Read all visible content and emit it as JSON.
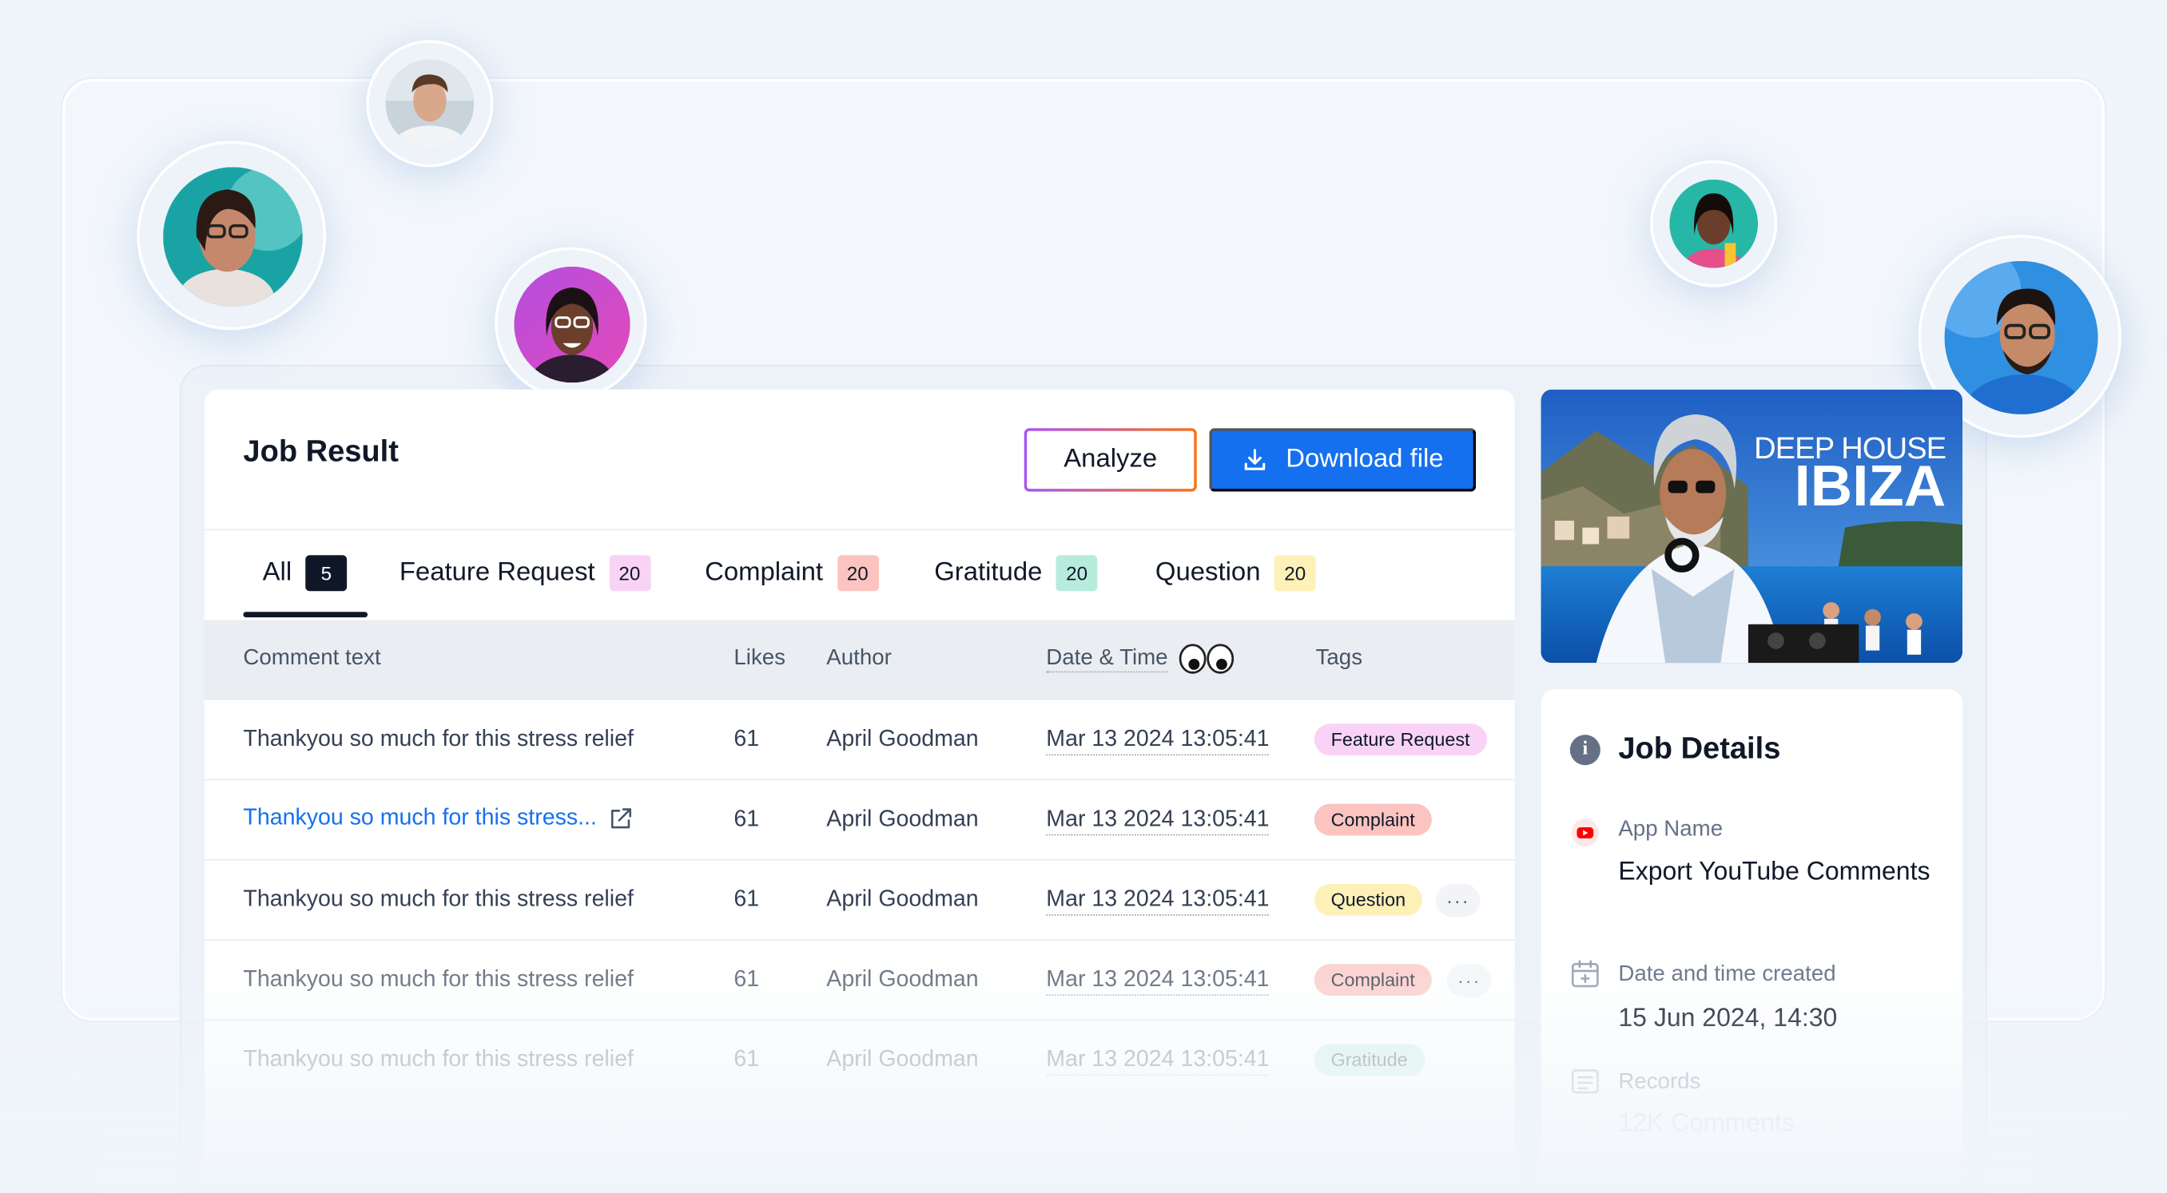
{
  "job_result": {
    "title": "Job Result",
    "analyze_label": "Analyze",
    "download_label": "Download file",
    "tabs": [
      {
        "label": "All",
        "count": "5",
        "color": "#101828",
        "text_color": "#ffffff"
      },
      {
        "label": "Feature Request",
        "count": "20",
        "color": "#f9d3f5",
        "text_color": "#101828"
      },
      {
        "label": "Complaint",
        "count": "20",
        "color": "#fbc4c0",
        "text_color": "#101828"
      },
      {
        "label": "Gratitude",
        "count": "20",
        "color": "#b7ecdd",
        "text_color": "#101828"
      },
      {
        "label": "Question",
        "count": "20",
        "color": "#fdf1b8",
        "text_color": "#101828"
      }
    ],
    "columns": {
      "comment": "Comment text",
      "likes": "Likes",
      "author": "Author",
      "date": "Date & Time",
      "tags": "Tags"
    },
    "rows": [
      {
        "comment": "Thankyou so much for this stress relief",
        "likes": "61",
        "author": "April Goodman",
        "date": "Mar 13 2024 13:05:41",
        "tag": "Feature Request",
        "tag_color": "#f9d3f5"
      },
      {
        "comment": "Thankyou so much for this stress...",
        "likes": "61",
        "author": "April Goodman",
        "date": "Mar 13 2024 13:05:41",
        "tag": "Complaint",
        "tag_color": "#fbc4c0"
      },
      {
        "comment": "Thankyou so much for this stress relief",
        "likes": "61",
        "author": "April Goodman",
        "date": "Mar 13 2024 13:05:41",
        "tag": "Question",
        "tag_color": "#fdf1b8",
        "more": "···"
      },
      {
        "comment": "Thankyou so much for this stress relief",
        "likes": "61",
        "author": "April Goodman",
        "date": "Mar 13 2024 13:05:41",
        "tag": "Complaint",
        "tag_color": "#fbc4c0",
        "more": "···"
      },
      {
        "comment": "Thankyou so much for this stress relief",
        "likes": "61",
        "author": "April Goodman",
        "date": "Mar 13 2024 13:05:41",
        "tag": "Gratitude",
        "tag_color": "#b7ecdd"
      }
    ]
  },
  "thumbnail": {
    "title_line1": "DEEP HOUSE",
    "title_line2": "IBIZA"
  },
  "job_details": {
    "title": "Job Details",
    "app_name_label": "App Name",
    "app_name_value": "Export YouTube Comments",
    "created_label": "Date and time created",
    "created_value": "15 Jun 2024, 14:30",
    "records_label": "Records",
    "records_value": "12K Comments"
  },
  "colors": {
    "accent": "#1570ef",
    "youtube_red": "#ff0000"
  }
}
